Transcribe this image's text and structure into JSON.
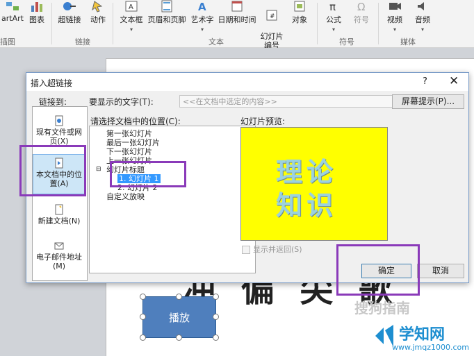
{
  "ribbon": {
    "buttons": [
      {
        "label": "artArt"
      },
      {
        "label": "图表"
      },
      {
        "label": "超链接"
      },
      {
        "label": "动作"
      },
      {
        "label": "文本框"
      },
      {
        "label": "页眉和页脚"
      },
      {
        "label": "艺术字"
      },
      {
        "label": "日期和时间"
      },
      {
        "label": "幻灯片\n编号"
      },
      {
        "label": "对象"
      },
      {
        "label": "公式"
      },
      {
        "label": "符号"
      },
      {
        "label": "视频"
      },
      {
        "label": "音频"
      }
    ],
    "groups": [
      "插图",
      "链接",
      "文本",
      "符号",
      "媒体"
    ]
  },
  "slide": {
    "background_text": "冲 偏 尖 歌",
    "shape_label": "播放",
    "watermark": "搜狗指南"
  },
  "brand": {
    "name": "学知网",
    "url": "www.jmqz1000.com"
  },
  "dialog": {
    "title": "插入超链接",
    "help": "?",
    "close": "✕",
    "link_to_label": "链接到:",
    "display_text_label": "要显示的文字(T):",
    "display_text_value": "<<在文档中选定的内容>>",
    "screentip_button": "屏幕提示(P)...",
    "place_label": "请选择文档中的位置(C):",
    "preview_label": "幻灯片预览:",
    "link_items": [
      {
        "label": "现有文件或网页(X)"
      },
      {
        "label": "本文档中的位置(A)"
      },
      {
        "label": "新建文档(N)"
      },
      {
        "label": "电子邮件地址(M)"
      }
    ],
    "tree": [
      "第一张幻灯片",
      "最后一张幻灯片",
      "下一张幻灯片",
      "上一张幻灯片",
      "幻灯片标题",
      "1. 幻灯片 1",
      "2. 幻灯片 2",
      "自定义放映"
    ],
    "preview_lines": [
      "理论",
      "知识"
    ],
    "checkbox_label": "显示并返回(S)",
    "ok": "确定",
    "cancel": "取消"
  },
  "colors": {
    "highlight": "#8a3ab9",
    "preview_bg": "#ffff00",
    "shape_fill": "#4f7fbd"
  }
}
